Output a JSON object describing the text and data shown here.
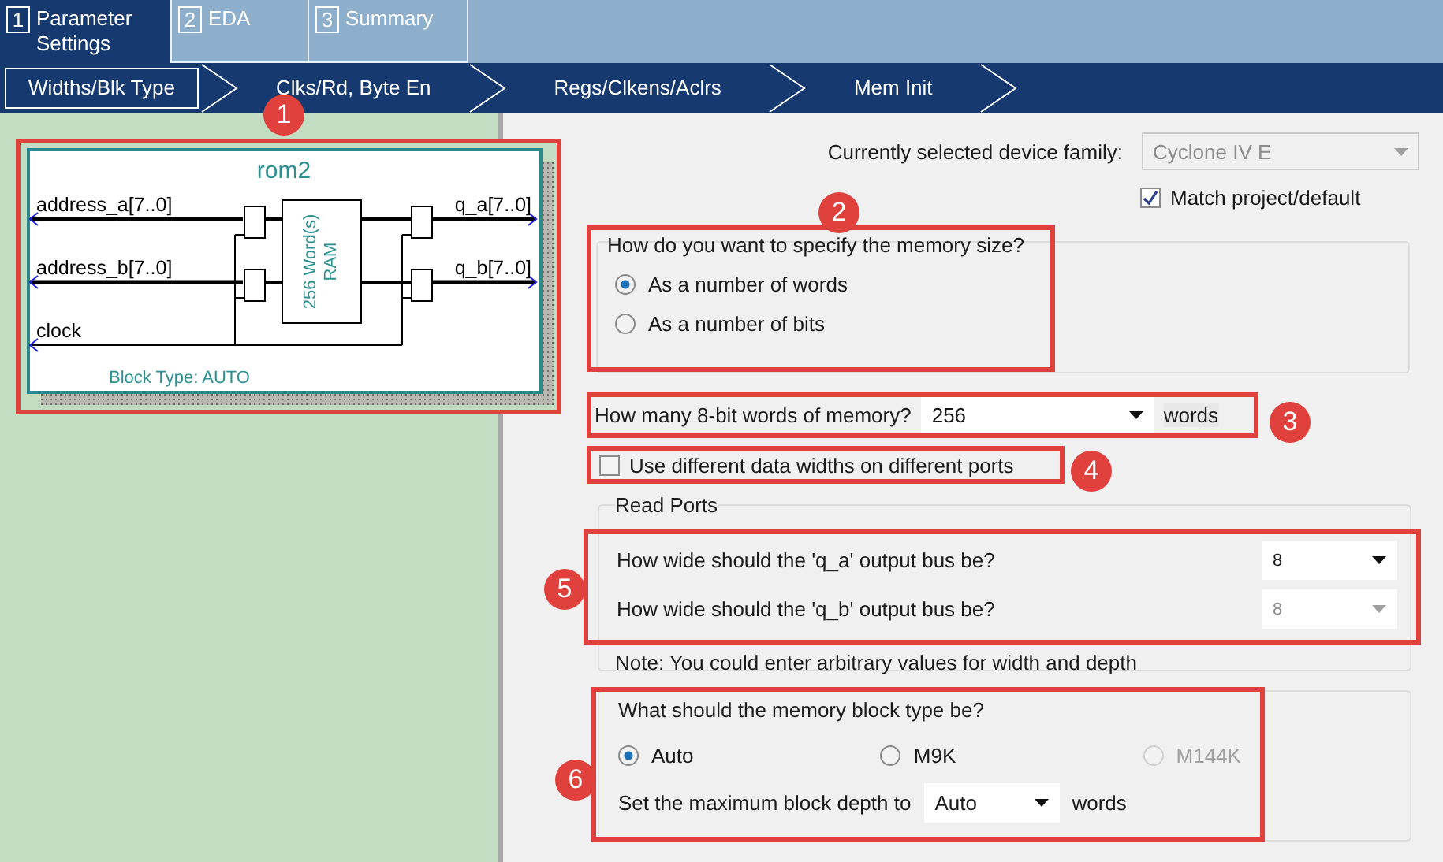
{
  "tabs": [
    {
      "number": "1",
      "label": "Parameter Settings",
      "selected": true
    },
    {
      "number": "2",
      "label": "EDA",
      "selected": false
    },
    {
      "number": "3",
      "label": "Summary",
      "selected": false
    }
  ],
  "steps": [
    {
      "label": "Widths/Blk Type",
      "selected": true
    },
    {
      "label": "Clks/Rd, Byte En",
      "selected": false
    },
    {
      "label": "Regs/Clkens/Aclrs",
      "selected": false
    },
    {
      "label": "Mem Init",
      "selected": false
    }
  ],
  "diagram": {
    "title": "rom2",
    "inputs": [
      "address_a[7..0]",
      "address_b[7..0]",
      "clock"
    ],
    "outputs": [
      "q_a[7..0]",
      "q_b[7..0]"
    ],
    "block_lines": [
      "256 Word(s)",
      "RAM"
    ],
    "footer": "Block Type: AUTO"
  },
  "device_family": {
    "label": "Currently selected device family:",
    "value": "Cyclone IV E",
    "disabled": true
  },
  "match_project": {
    "label": "Match project/default",
    "checked": true
  },
  "memory_size": {
    "title": "How do you want to specify the memory size?",
    "options": [
      {
        "label": "As a number of words",
        "selected": true
      },
      {
        "label": "As a number of bits",
        "selected": false
      }
    ]
  },
  "word_count": {
    "label": "How many 8-bit words of memory?",
    "value": "256",
    "unit": "words"
  },
  "different_widths": {
    "label": "Use different data widths on different ports",
    "checked": false
  },
  "read_ports": {
    "title": "Read Ports",
    "rows": [
      {
        "label": "How wide should the 'q_a' output bus be?",
        "value": "8",
        "disabled": false
      },
      {
        "label": "How wide should the 'q_b' output bus be?",
        "value": "8",
        "disabled": true
      }
    ],
    "note": "Note: You could enter arbitrary values for width and depth"
  },
  "block_type": {
    "title": "What should the memory block type be?",
    "options": [
      {
        "label": "Auto",
        "selected": true,
        "disabled": false
      },
      {
        "label": "M9K",
        "selected": false,
        "disabled": false
      },
      {
        "label": "M144K",
        "selected": false,
        "disabled": true
      }
    ],
    "depth": {
      "label": "Set the maximum block depth to",
      "value": "Auto",
      "unit": "words"
    }
  },
  "annotations": [
    "1",
    "2",
    "3",
    "4",
    "5",
    "6"
  ]
}
